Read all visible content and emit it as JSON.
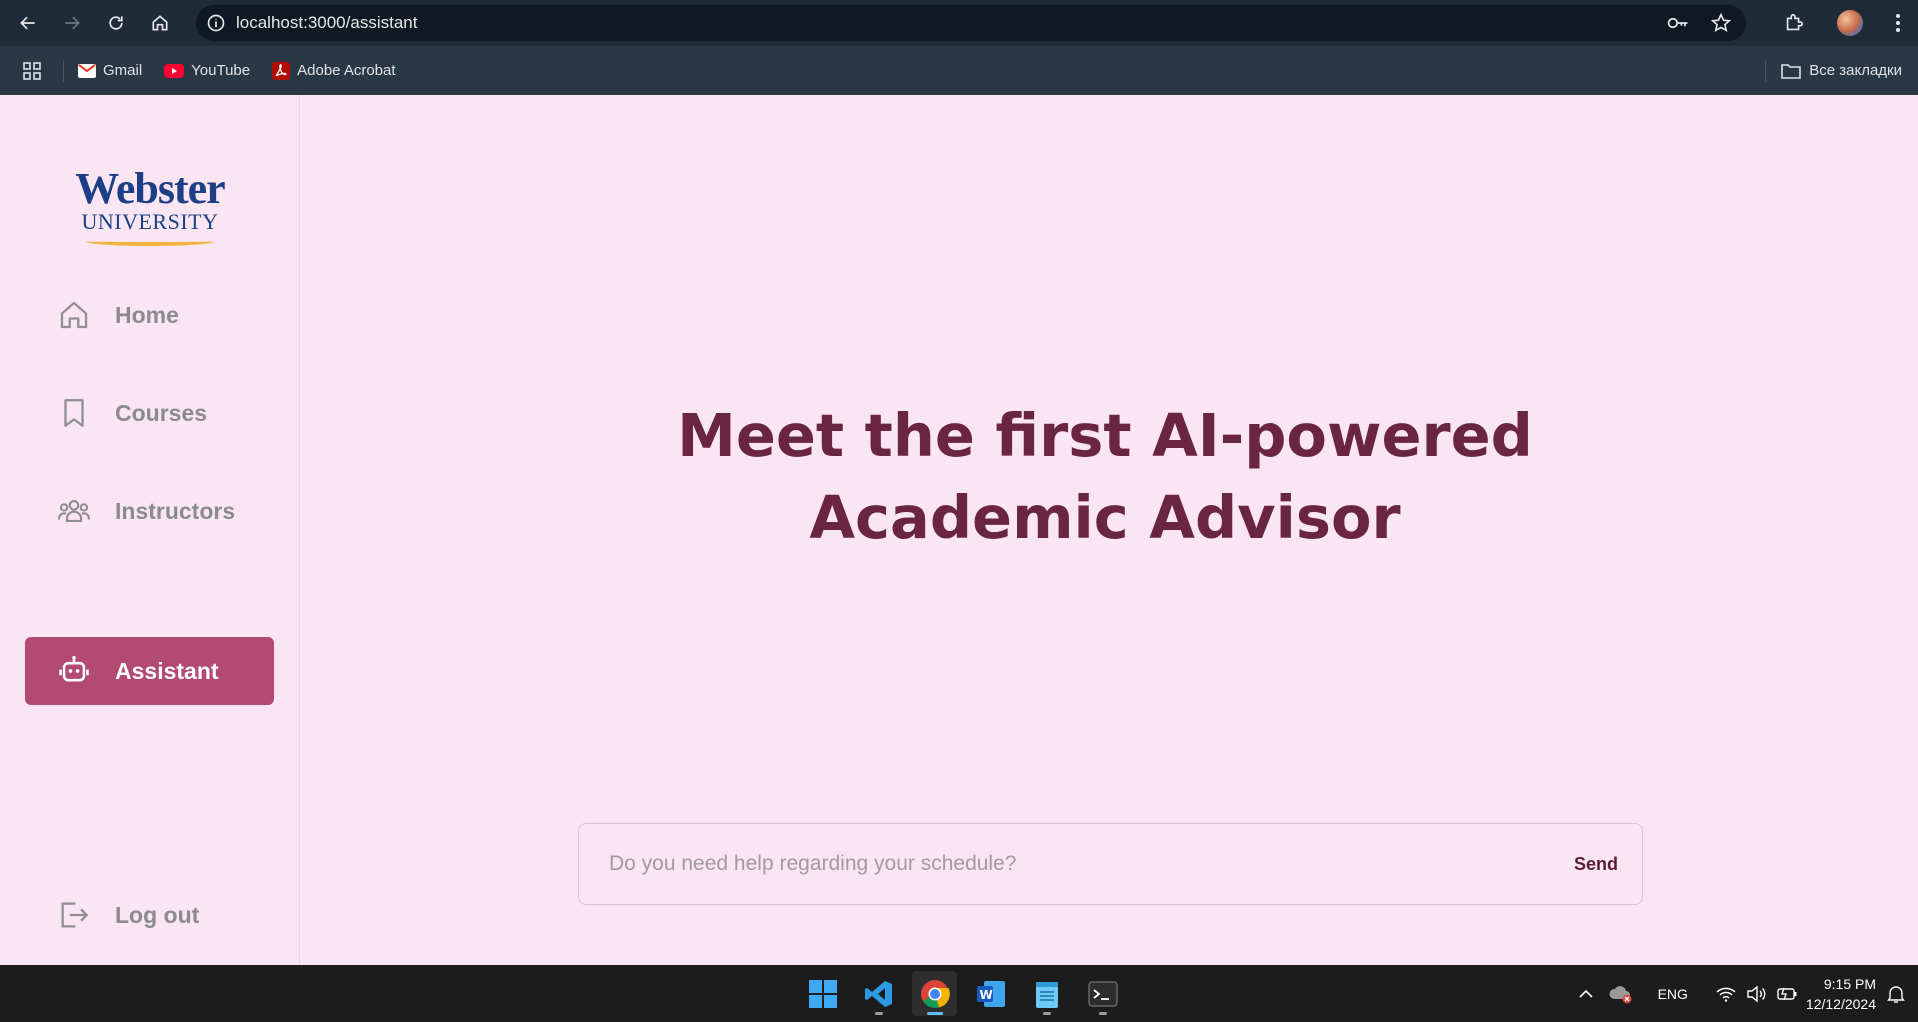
{
  "browser": {
    "url": "localhost:3000/assistant",
    "bookmarks": [
      {
        "label": "Gmail",
        "icon": "gmail-icon"
      },
      {
        "label": "YouTube",
        "icon": "youtube-icon"
      },
      {
        "label": "Adobe Acrobat",
        "icon": "acrobat-icon"
      }
    ],
    "all_bookmarks_label": "Все закладки"
  },
  "logo": {
    "line1": "Webster",
    "line2": "UNIVERSITY"
  },
  "sidebar": {
    "items": [
      {
        "label": "Home",
        "icon": "home-icon"
      },
      {
        "label": "Courses",
        "icon": "bookmark-icon"
      },
      {
        "label": "Instructors",
        "icon": "users-icon"
      },
      {
        "label": "Assistant",
        "icon": "robot-icon",
        "active": true
      }
    ],
    "logout": {
      "label": "Log out",
      "icon": "logout-icon"
    }
  },
  "main": {
    "headline": "Meet the first AI-powered Academic Advisor",
    "chat": {
      "placeholder": "Do you need help regarding your schedule?",
      "send_label": "Send"
    }
  },
  "taskbar": {
    "language": "ENG",
    "time": "9:15 PM",
    "date": "12/12/2024"
  },
  "colors": {
    "accent": "#b24a72",
    "headline": "#6a2640",
    "background": "#fae6f2"
  }
}
